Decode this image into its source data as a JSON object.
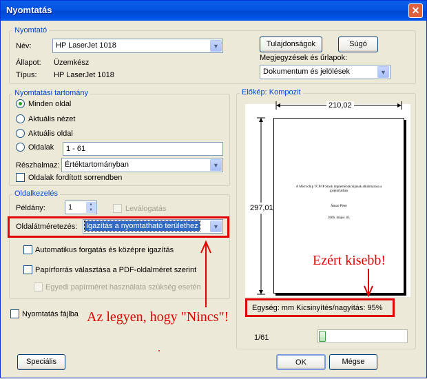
{
  "window": {
    "title": "Nyomtatás",
    "close_glyph": "✕"
  },
  "printer": {
    "legend": "Nyomtató",
    "name_label": "Név:",
    "name_value": "HP LaserJet 1018",
    "status_label": "Állapot:",
    "status_value": "Üzemkész",
    "type_label": "Típus:",
    "type_value": "HP LaserJet 1018",
    "properties_button": "Tulajdonságok",
    "help_button": "Súgó",
    "comments_label": "Megjegyzések és űrlapok:",
    "comments_value": "Dokumentum és jelölések"
  },
  "range": {
    "legend": "Nyomtatási tartomány",
    "all_pages": "Minden oldal",
    "current_view": "Aktuális nézet",
    "current_page": "Aktuális oldal",
    "pages": "Oldalak",
    "pages_value": "1 - 61",
    "subset_label": "Részhalmaz:",
    "subset_value": "Értéktartományban",
    "reverse_pages": "Oldalak fordított sorrendben"
  },
  "handling": {
    "legend": "Oldalkezelés",
    "copies_label": "Példány:",
    "copies_value": "1",
    "collate": "Leválogatás",
    "scaling_label": "Oldalátméretezés:",
    "scaling_value": "Igazítás a nyomtatható területhez",
    "auto_rotate": "Automatikus forgatás és középre igazítás",
    "paper_source": "Papírforrás választása a PDF-oldalméret szerint",
    "custom_paper": "Egyedi papírméret használata szükség esetén"
  },
  "print_to_file": "Nyomtatás fájlba",
  "preview": {
    "legend": "Előkép: Kompozit",
    "width": "210,02",
    "height": "297,01",
    "page_title": "A Microchip TCP/IP Stack implementációjának alkalmazása a gyakorlatban",
    "page_author": "Ámon Péter",
    "page_date": "2006. május 18.",
    "unit_scale": "Egység: mm Kicsinyítés/nagyítás:  95%",
    "page_counter": "1/61"
  },
  "annotations": {
    "smaller": "Ezért kisebb!",
    "should_be_none": "Az legyen, hogy \"Nincs\"!"
  },
  "buttons": {
    "special": "Speciális",
    "ok": "OK",
    "cancel": "Mégse"
  },
  "colors": {
    "accent_red": "#e00000",
    "legend_blue": "#0046d5",
    "selection_blue": "#316ac5"
  }
}
